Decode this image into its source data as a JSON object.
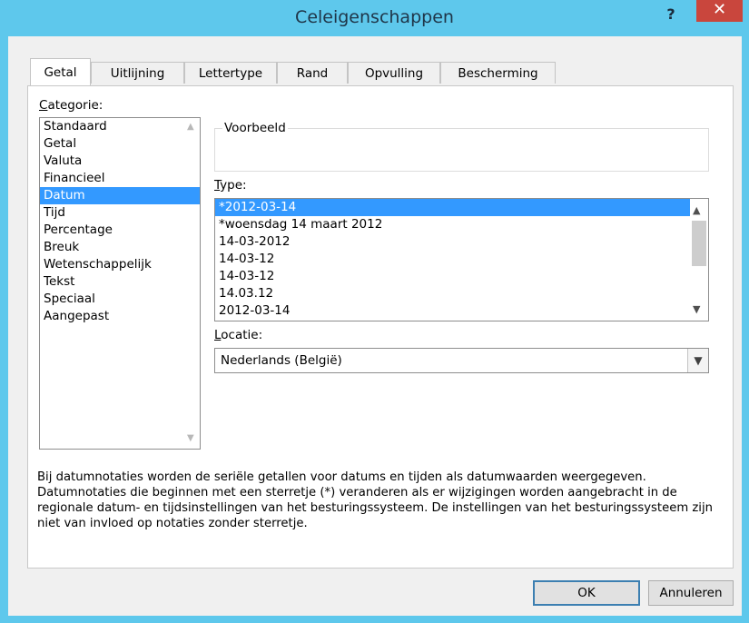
{
  "window": {
    "title": "Celeigenschappen",
    "help_label": "?",
    "close_label": "✕"
  },
  "tabs": [
    "Getal",
    "Uitlijning",
    "Lettertype",
    "Rand",
    "Opvulling",
    "Bescherming"
  ],
  "active_tab": "Getal",
  "category": {
    "label": "Categorie:",
    "items": [
      "Standaard",
      "Getal",
      "Valuta",
      "Financieel",
      "Datum",
      "Tijd",
      "Percentage",
      "Breuk",
      "Wetenschappelijk",
      "Tekst",
      "Speciaal",
      "Aangepast"
    ],
    "selected": "Datum"
  },
  "preview": {
    "legend": "Voorbeeld",
    "value": ""
  },
  "type": {
    "label": "Type:",
    "items": [
      "*2012-03-14",
      "*woensdag 14 maart 2012",
      "14-03-2012",
      "14-03-12",
      "14-03-12",
      "14.03.12",
      "2012-03-14"
    ],
    "selected": "*2012-03-14"
  },
  "locatie": {
    "label": "Locatie:",
    "value": "Nederlands (België)"
  },
  "description": "Bij datumnotaties worden de seriële getallen voor datums en tijden als datumwaarden weergegeven. Datumnotaties die beginnen met een sterretje (*) veranderen als er wijzigingen worden aangebracht in de regionale datum- en tijdsinstellingen van het besturingssysteem. De instellingen van het besturingssysteem zijn niet van invloed op notaties zonder sterretje.",
  "buttons": {
    "ok": "OK",
    "cancel": "Annuleren"
  },
  "icons": {
    "scroll_up": "scroll-up-icon",
    "scroll_down": "scroll-down-icon",
    "dropdown": "chevron-down-icon"
  }
}
